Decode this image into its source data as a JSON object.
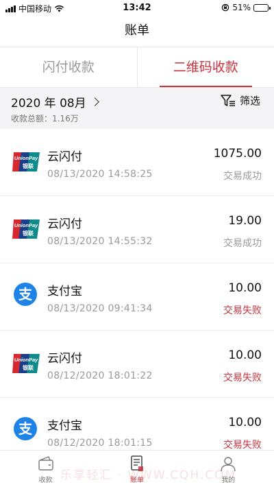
{
  "status_bar": {
    "carrier": "中国移动",
    "time": "13:42",
    "battery_text": "51%",
    "battery_level": 0.51
  },
  "nav": {
    "title": "账单"
  },
  "tabs": [
    {
      "label": "闪付收款",
      "active": false
    },
    {
      "label": "二维码收款",
      "active": true
    }
  ],
  "filter": {
    "month": "2020 年 08月",
    "total": "收款总额：1.16万",
    "filter_label": "筛选"
  },
  "transactions": [
    {
      "channel": "unionpay",
      "name": "云闪付",
      "datetime": "08/13/2020 14:58:25",
      "amount": "1075.00",
      "status": "交易成功",
      "ok": true
    },
    {
      "channel": "unionpay",
      "name": "云闪付",
      "datetime": "08/13/2020 14:55:32",
      "amount": "19.00",
      "status": "交易成功",
      "ok": true
    },
    {
      "channel": "alipay",
      "name": "支付宝",
      "datetime": "08/13/2020 09:41:34",
      "amount": "10.00",
      "status": "交易失败",
      "ok": false
    },
    {
      "channel": "unionpay",
      "name": "云闪付",
      "datetime": "08/12/2020 18:01:22",
      "amount": "10.00",
      "status": "交易失败",
      "ok": false
    },
    {
      "channel": "alipay",
      "name": "支付宝",
      "datetime": "08/12/2020 18:01:15",
      "amount": "10.00",
      "status": "交易失败",
      "ok": false
    }
  ],
  "logos": {
    "unionpay_text": "UnionPay",
    "unionpay_cn": "银联",
    "alipay_char": "支"
  },
  "tabbar": [
    {
      "label": "收款",
      "icon": "wallet-icon",
      "active": false
    },
    {
      "label": "账单",
      "icon": "bill-icon",
      "active": true
    },
    {
      "label": "我的",
      "icon": "user-icon",
      "active": false
    }
  ],
  "watermark": "乐享轻汇 · WWW.CQH.COM",
  "colors": {
    "accent": "#c8323c",
    "alipay": "#1d83e6",
    "muted": "#9a9a9a"
  }
}
